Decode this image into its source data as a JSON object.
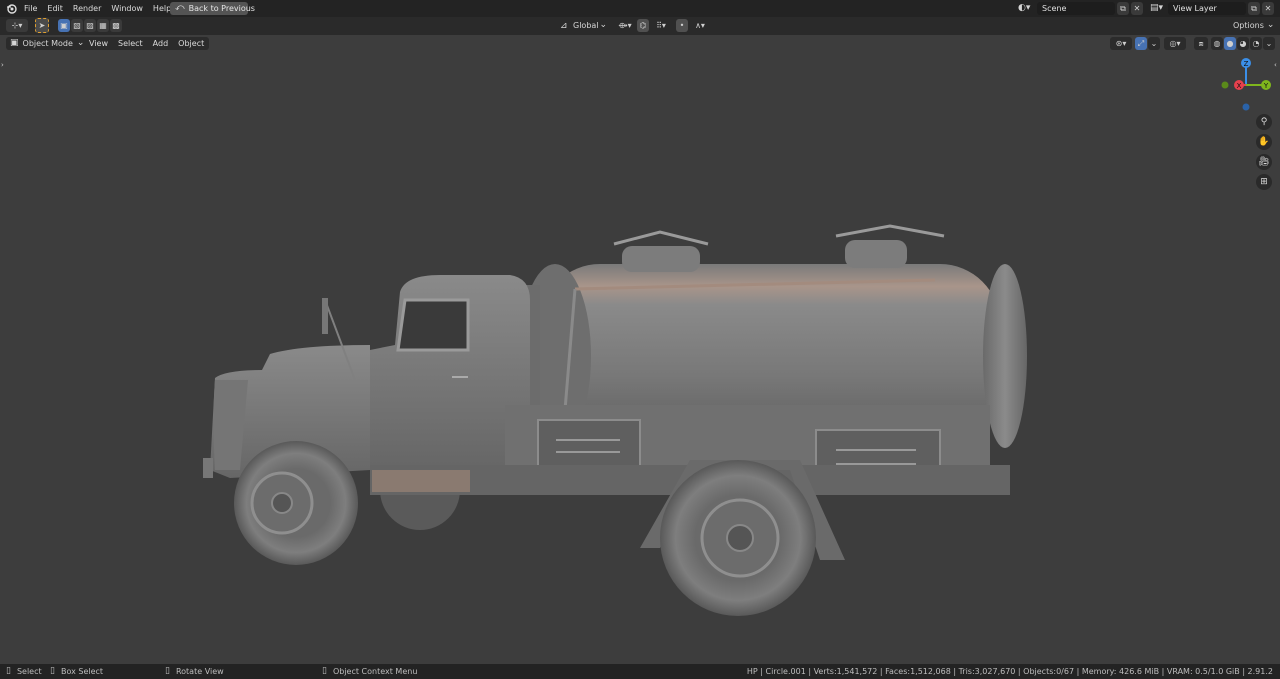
{
  "topbar": {
    "menus": [
      "File",
      "Edit",
      "Render",
      "Window",
      "Help"
    ],
    "back_button": "Back to Previous",
    "scene_field": "Scene",
    "view_layer_field": "View Layer"
  },
  "toolheader": {
    "transform_orientation": "Global",
    "options_label": "Options"
  },
  "viewheader": {
    "mode_label": "Object Mode",
    "menus": [
      "View",
      "Select",
      "Add",
      "Object"
    ]
  },
  "gizmo": {
    "z_label": "Z",
    "x_label": "X",
    "y_label": "Y",
    "colors": {
      "x": "#e8404d",
      "y": "#7fb61d",
      "z": "#3b8fe8"
    }
  },
  "statusbar": {
    "select": "Select",
    "box_select": "Box Select",
    "rotate_view": "Rotate View",
    "context_menu": "Object Context Menu",
    "stats": "HP | Circle.001 | Verts:1,541,572 | Faces:1,512,068 | Tris:3,027,670 | Objects:0/67 | Memory: 426.6 MiB | VRAM: 0.5/1.0 GiB | 2.91.2"
  },
  "viewport": {
    "background": "#3d3d3d",
    "subject": "tanker-truck-model"
  }
}
